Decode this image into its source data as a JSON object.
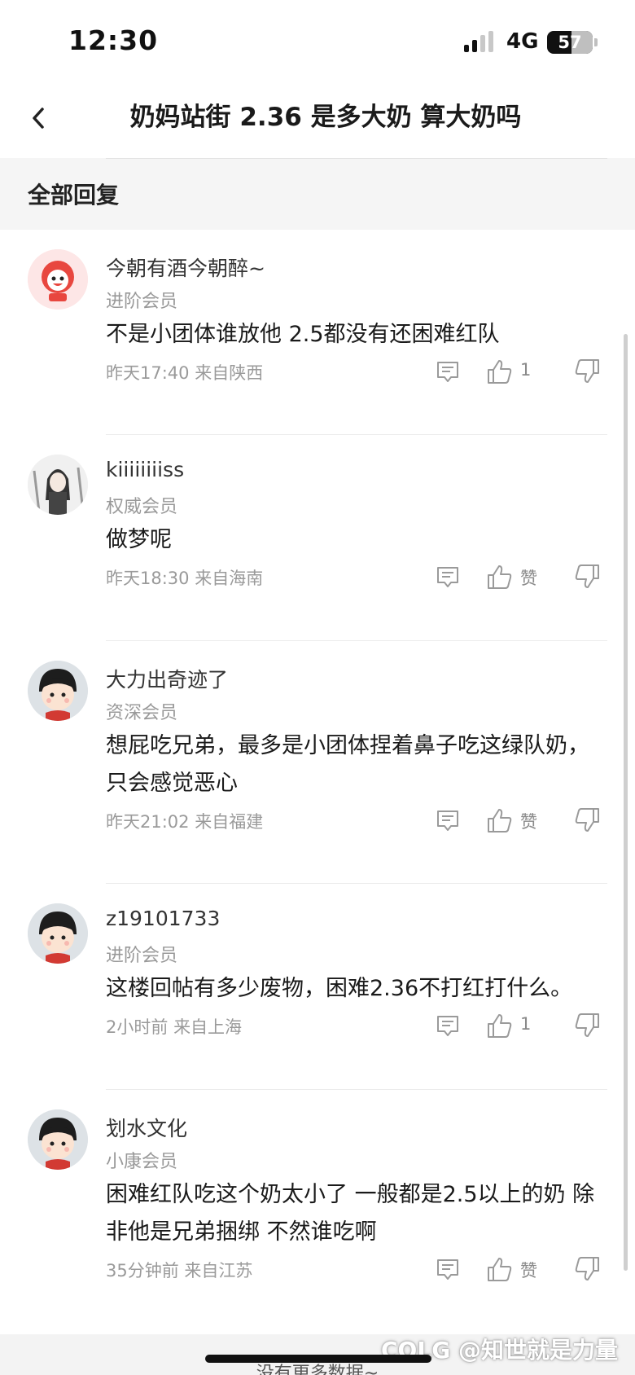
{
  "status_bar": {
    "time": "12:30",
    "network": "4G",
    "battery": "57"
  },
  "header": {
    "title": "奶妈站街 2.36 是多大奶 算大奶吗"
  },
  "section": {
    "label": "全部回复"
  },
  "comments": [
    {
      "name": "今朝有酒今朝醉~",
      "level": "进阶会员",
      "text": "不是小团体谁放他 2.5都没有还困难红队",
      "time": "昨天17:40",
      "location": "来自陕西",
      "likes": "1",
      "avatar": "red-cartoon-avatar"
    },
    {
      "name": "kiiiiiiiiss",
      "level": "权威会员",
      "text": "做梦呢",
      "time": "昨天18:30",
      "location": "来自海南",
      "likes": "赞",
      "avatar": "anime-girl-avatar"
    },
    {
      "name": "大力出奇迹了",
      "level": "资深会员",
      "text": "想屁吃兄弟，最多是小团体捏着鼻子吃这绿队奶，只会感觉恶心",
      "time": "昨天21:02",
      "location": "来自福建",
      "likes": "赞",
      "avatar": "default-boy-avatar"
    },
    {
      "name": "z19101733",
      "level": "进阶会员",
      "text": "这楼回帖有多少废物，困难2.36不打红打什么。",
      "time": "2小时前",
      "location": "来自上海",
      "likes": "1",
      "avatar": "default-boy-avatar"
    },
    {
      "name": "划水文化",
      "level": "小康会员",
      "text": "困难红队吃这个奶太小了 一般都是2.5以上的奶  除非他是兄弟捆绑 不然谁吃啊",
      "time": "35分钟前",
      "location": "来自江苏",
      "likes": "赞",
      "avatar": "default-boy-avatar"
    }
  ],
  "footer": {
    "no_more": "没有更多数据~"
  },
  "watermark": {
    "text": "@知世就是力量",
    "logo": "COLG"
  },
  "colors": {
    "section_bg": "#f5f5f5",
    "text_primary": "#1a1a1a",
    "text_secondary": "#999999",
    "accent_red": "#e8473f"
  }
}
